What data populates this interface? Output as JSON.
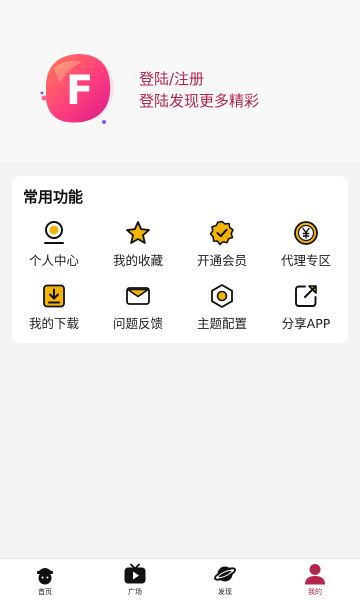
{
  "colors": {
    "accent": "#b3264d",
    "icon_yellow": "#f5b400",
    "icon_dark": "#111111",
    "background": "#f3f3f3",
    "card": "#ffffff"
  },
  "status_bar": {
    "icons": [
      "wifi-icon",
      "battery-icon"
    ]
  },
  "profile": {
    "logo_letter": "F",
    "login_label": "登陆/注册",
    "subtitle": "登陆发现更多精彩"
  },
  "functions": {
    "title": "常用功能",
    "items": [
      {
        "label": "个人中心",
        "icon": "person-icon"
      },
      {
        "label": "我的收藏",
        "icon": "star-icon"
      },
      {
        "label": "开通会员",
        "icon": "vip-badge-icon"
      },
      {
        "label": "代理专区",
        "icon": "yen-coin-icon"
      },
      {
        "label": "我的下载",
        "icon": "download-icon"
      },
      {
        "label": "问题反馈",
        "icon": "mail-icon"
      },
      {
        "label": "主题配置",
        "icon": "theme-icon"
      },
      {
        "label": "分享APP",
        "icon": "share-icon"
      }
    ]
  },
  "tabbar": {
    "active_index": 3,
    "tabs": [
      {
        "label": "首页",
        "icon": "home-avatar-icon"
      },
      {
        "label": "广场",
        "icon": "video-icon"
      },
      {
        "label": "发现",
        "icon": "planet-icon"
      },
      {
        "label": "我的",
        "icon": "user-icon"
      }
    ]
  }
}
